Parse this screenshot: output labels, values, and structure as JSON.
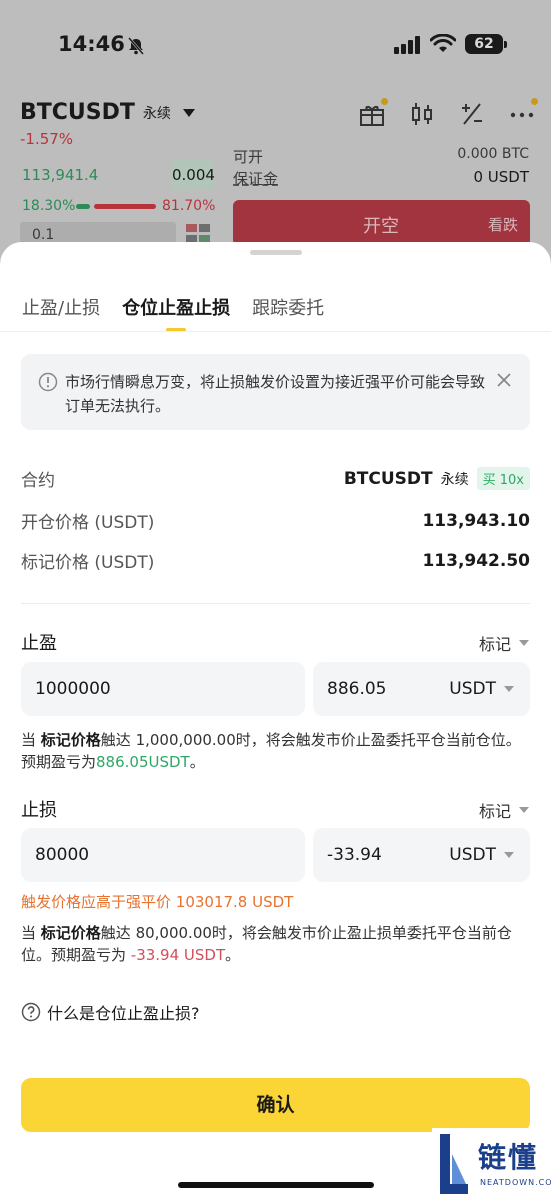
{
  "status_bar": {
    "time": "14:46",
    "battery": "62"
  },
  "background": {
    "pair": "BTCUSDT",
    "pair_type": "永续",
    "change": "-1.57%",
    "price": "113,941.4",
    "qty": "0.004",
    "buy_pct": "18.30%",
    "sell_pct": "81.70%",
    "depth_select": "0.1",
    "available_label": "可开",
    "available_value": "0.000 BTC",
    "margin_label": "保证金",
    "margin_value": "0 USDT",
    "short_label": "开空",
    "short_sub": "看跌"
  },
  "tabs": [
    {
      "label": "止盈/止损",
      "active": false
    },
    {
      "label": "仓位止盈止损",
      "active": true
    },
    {
      "label": "跟踪委托",
      "active": false
    }
  ],
  "notice": {
    "text": "市场行情瞬息万变，将止损触发价设置为接近强平价可能会导致订单无法执行。"
  },
  "info": {
    "contract_label": "合约",
    "contract_value": "BTCUSDT",
    "contract_type": "永续",
    "leverage": "买 10x",
    "open_price_label": "开仓价格 (USDT)",
    "open_price_value": "113,943.10",
    "mark_price_label": "标记价格 (USDT)",
    "mark_price_value": "113,942.50"
  },
  "take_profit": {
    "title": "止盈",
    "trigger_type": "标记",
    "price": "1000000",
    "pnl": "886.05",
    "unit": "USDT",
    "desc_prefix": "当 ",
    "desc_bold": "标记价格",
    "desc_mid": "触达 1,000,000.00时，将会触发市价止盈委托平仓当前仓位。预期盈亏为",
    "desc_pnl": "886.05USDT",
    "desc_end": "。"
  },
  "stop_loss": {
    "title": "止损",
    "trigger_type": "标记",
    "price": "80000",
    "pnl": "-33.94",
    "unit": "USDT",
    "warning": "触发价格应高于强平价 103017.8 USDT",
    "desc_prefix": "当 ",
    "desc_bold": "标记价格",
    "desc_mid": "触达 80,000.00时，将会触发市价止盈止损单委托平仓当前仓位。预期盈亏为 ",
    "desc_pnl": "-33.94 USDT",
    "desc_end": "。"
  },
  "help": {
    "text": "什么是仓位止盈止损?"
  },
  "confirm": {
    "label": "确认"
  },
  "watermark": {
    "text": "链懂",
    "sub": "NEATDOWN.COM"
  },
  "colors": {
    "accent": "#fbd535",
    "green": "#2ea866",
    "red": "#d04f5f",
    "warning": "#e8732f"
  }
}
